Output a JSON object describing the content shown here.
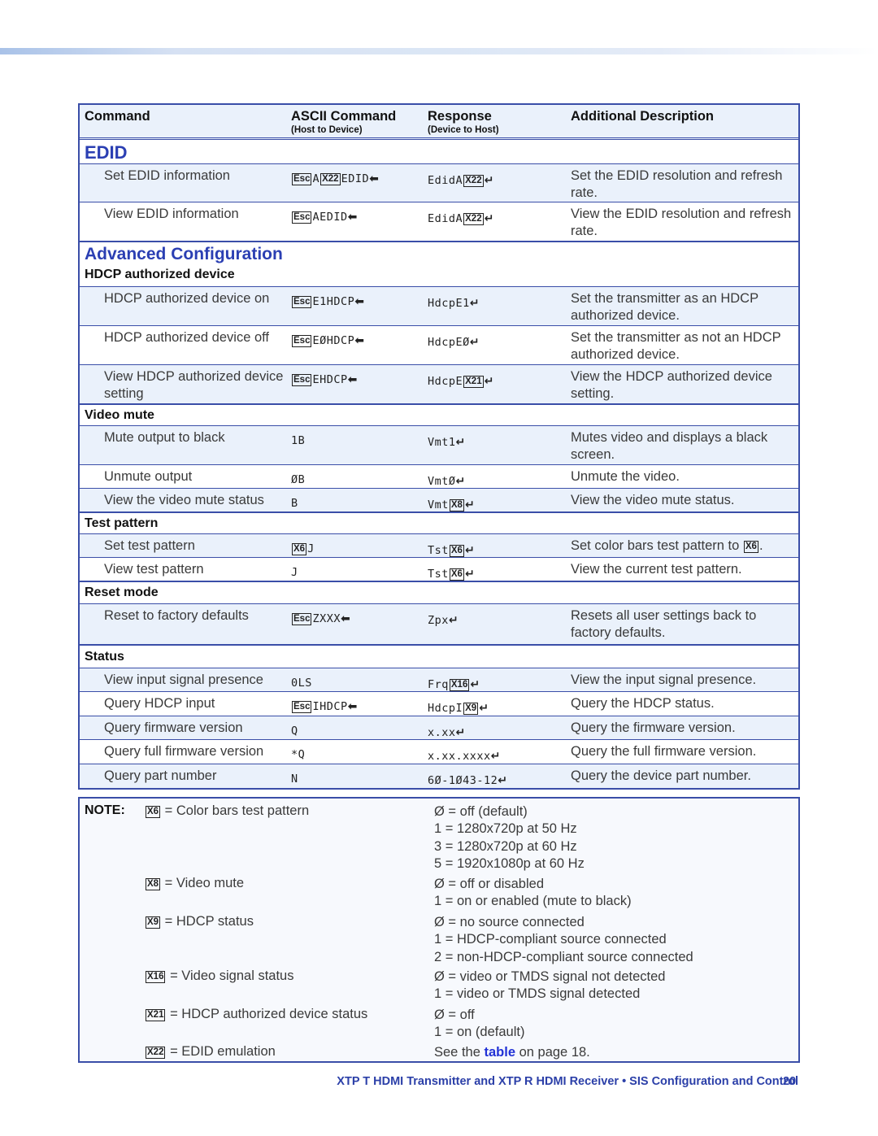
{
  "header": {
    "command": "Command",
    "ascii": "ASCII Command",
    "ascii_sub": "(Host to Device)",
    "response": "Response",
    "response_sub": "(Device to Host)",
    "description": "Additional Description"
  },
  "edid": {
    "title": "EDID",
    "rows": [
      {
        "command": "Set EDID information",
        "ascii_pre": "A",
        "ascii_key": "X22",
        "ascii_post": "EDID",
        "resp_pre": "EdidA",
        "resp_key": "X22",
        "desc": "Set the EDID resolution and refresh rate."
      },
      {
        "command": "View EDID information",
        "ascii_pre": "AEDID",
        "resp_pre": "EdidA",
        "resp_key": "X22",
        "desc": "View the EDID resolution and refresh rate."
      }
    ]
  },
  "advanced": {
    "title": "Advanced Configuration",
    "hdcp": {
      "title": "HDCP authorized device",
      "rows": [
        {
          "command": "HDCP authorized device on",
          "ascii": "E1HDCP",
          "resp": "HdcpE1",
          "desc": "Set the transmitter as an HDCP authorized device."
        },
        {
          "command": "HDCP authorized device off",
          "ascii": "EØHDCP",
          "resp": "HdcpEØ",
          "desc": "Set the transmitter as not an HDCP authorized device."
        },
        {
          "command": "View HDCP authorized device setting",
          "ascii": "EHDCP",
          "resp": "HdcpE",
          "resp_key": "X21",
          "desc": "View the HDCP authorized device setting."
        }
      ]
    },
    "video_mute": {
      "title": "Video mute",
      "rows": [
        {
          "command": "Mute output to black",
          "ascii": "1B",
          "resp": "Vmt1",
          "desc": "Mutes video and displays a black screen."
        },
        {
          "command": "Unmute output",
          "ascii": "ØB",
          "resp": "VmtØ",
          "desc": "Unmute the video."
        },
        {
          "command": "View the video mute status",
          "ascii": "B",
          "resp": "Vmt",
          "resp_key": "X8",
          "desc": "View the video mute status."
        }
      ]
    },
    "test_pattern": {
      "title": "Test pattern",
      "rows": [
        {
          "command": "Set test pattern",
          "ascii_key": "X6",
          "ascii": "J",
          "resp": "Tst",
          "resp_key": "X6",
          "desc": "Set color bars test pattern to",
          "desc_key": "X6"
        },
        {
          "command": "View test pattern",
          "ascii": "J",
          "resp": "Tst",
          "resp_key": "X6",
          "desc": "View the current test pattern."
        }
      ]
    },
    "reset": {
      "title": "Reset mode",
      "rows": [
        {
          "command": "Reset to factory defaults",
          "ascii": "ZXXX",
          "resp": "Zpx",
          "desc": "Resets all user settings back to factory defaults."
        }
      ]
    },
    "status": {
      "title": "Status",
      "rows": [
        {
          "command": "View input signal presence",
          "ascii": "0LS",
          "resp": "Frq",
          "resp_key": "X16",
          "desc": "View the input signal presence."
        },
        {
          "command": "Query HDCP input",
          "ascii": "IHDCP",
          "resp": "HdcpI",
          "resp_key": "X9",
          "desc": "Query the HDCP status."
        },
        {
          "command": "Query firmware version",
          "ascii": "Q",
          "resp": "x.xx",
          "desc": "Query the firmware version."
        },
        {
          "command": "Query full firmware version",
          "ascii": "*Q",
          "resp": "x.xx.xxxx",
          "desc": "Query the full firmware version."
        },
        {
          "command": "Query part number",
          "ascii": "N",
          "resp": "6Ø-1Ø43-12",
          "desc": "Query the device part number."
        }
      ]
    }
  },
  "keys": {
    "esc": "Esc"
  },
  "note": {
    "label": "NOTE:",
    "items": [
      {
        "key": "X6",
        "text": "= Color bars test pattern",
        "values": [
          "Ø = off (default)",
          "1 = 1280x720p at 50 Hz",
          "3 = 1280x720p at 60 Hz",
          "5 = 1920x1080p at 60 Hz"
        ]
      },
      {
        "key": "X8",
        "text": "= Video mute",
        "values": [
          "Ø = off or disabled",
          "1 = on or enabled (mute to black)"
        ]
      },
      {
        "key": "X9",
        "text": "= HDCP status",
        "values": [
          "Ø = no source connected",
          "1 = HDCP-compliant source connected",
          "2 = non-HDCP-compliant source connected"
        ]
      },
      {
        "key": "X16",
        "text": "= Video signal status",
        "values": [
          "Ø = video or TMDS signal not detected",
          "1 = video or TMDS signal detected"
        ]
      },
      {
        "key": "X21",
        "text": "= HDCP authorized device status",
        "values": [
          "Ø = off",
          "1 = on (default)"
        ]
      },
      {
        "key": "X22",
        "text": "= EDID emulation",
        "see_pre": "See the",
        "see_link": "table",
        "see_post": "on page 18."
      }
    ]
  },
  "footer": {
    "text": "XTP T HDMI Transmitter and XTP R HDMI Receiver • SIS Configuration and Control",
    "page": "20"
  },
  "colors": {
    "accent": "#2b3fb3",
    "border": "#3a4ea8",
    "row_tint": "#eaf1fb",
    "link": "#2232d6"
  }
}
